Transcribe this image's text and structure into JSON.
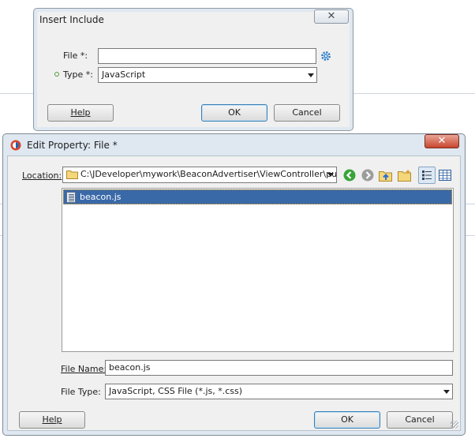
{
  "insert_include": {
    "title": "Insert Include",
    "close_glyph": "✕",
    "file_label": "File *:",
    "file_value": "",
    "type_label": "Type *:",
    "type_value": "JavaScript",
    "help_label": "Help",
    "ok_label": "OK",
    "cancel_label": "Cancel"
  },
  "edit_property": {
    "title": "Edit Property: File *",
    "close_glyph": "✕",
    "location_label": "Location:",
    "location_value": "C:\\JDeveloper\\mywork\\BeaconAdvertiser\\ViewController\\publ...",
    "files": [
      {
        "name": "beacon.js",
        "selected": true
      }
    ],
    "file_name_label": "File Name:",
    "file_name_value": "beacon.js",
    "file_type_label": "File Type:",
    "file_type_value": "JavaScript, CSS File (*.js, *.css)",
    "help_label": "Help",
    "ok_label": "OK",
    "cancel_label": "Cancel"
  },
  "icons": {
    "browse": "gear-icon",
    "back": "back-arrow-icon",
    "forward": "forward-arrow-icon",
    "up_folder": "up-folder-icon",
    "new_folder": "new-folder-icon",
    "list_view": "list-view-icon",
    "details_view": "details-view-icon"
  },
  "colors": {
    "selection": "#3a69a8",
    "close_button": "#c8462e",
    "dialog_frame": "#dfe8f1"
  }
}
